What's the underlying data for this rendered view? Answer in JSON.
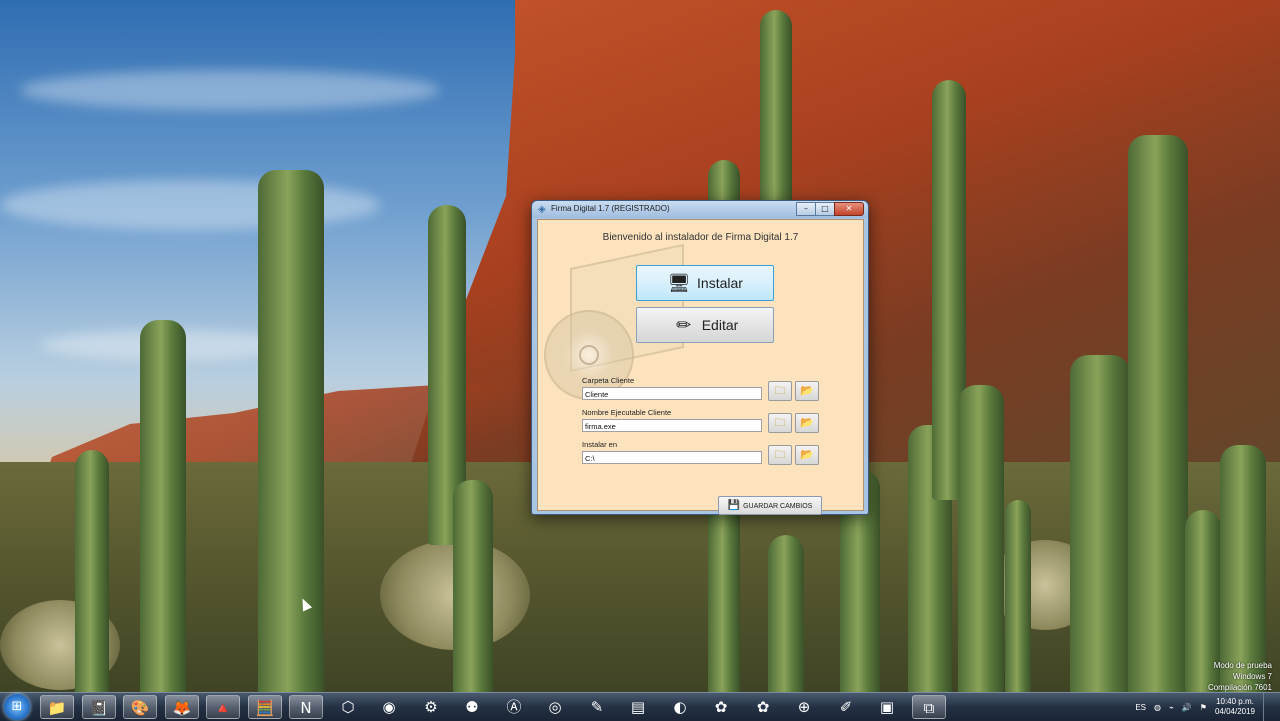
{
  "window": {
    "title": "Firma Digital 1.7 (REGISTRADO)",
    "buttons": {
      "minimize": "–",
      "maximize": "□",
      "close": "✕"
    }
  },
  "installer": {
    "welcome": "Bienvenido al instalador de Firma Digital 1.7",
    "install_label": "Instalar",
    "edit_label": "Editar",
    "fields": [
      {
        "label": "Carpeta Cliente",
        "value": "Cliente"
      },
      {
        "label": "Nombre Ejecutable Cliente",
        "value": "firma.exe"
      },
      {
        "label": "Instalar en",
        "value": "C:\\"
      }
    ],
    "save_label": "GUARDAR CAMBIOS"
  },
  "watermark": {
    "line1": "Modo de prueba",
    "line2": "Windows 7",
    "line3": "Compilación 7601"
  },
  "taskbar": {
    "start_glyph": "⊞",
    "items": [
      {
        "name": "explorer-icon",
        "glyph": "📁"
      },
      {
        "name": "notes-icon",
        "glyph": "📓"
      },
      {
        "name": "paint-icon",
        "glyph": "🎨"
      },
      {
        "name": "firefox-icon",
        "glyph": "🦊"
      },
      {
        "name": "vlc-icon",
        "glyph": "🔺"
      },
      {
        "name": "calculator-icon",
        "glyph": "🧮"
      },
      {
        "name": "onenote-icon",
        "glyph": "N"
      },
      {
        "name": "box-icon",
        "glyph": "⬡"
      },
      {
        "name": "chrome-icon",
        "glyph": "◉"
      },
      {
        "name": "settings-icon",
        "glyph": "⚙"
      },
      {
        "name": "remote-icon",
        "glyph": "⚉"
      },
      {
        "name": "app-a-icon",
        "glyph": "Ⓐ"
      },
      {
        "name": "obs-icon",
        "glyph": "◎"
      },
      {
        "name": "editor-icon",
        "glyph": "✎"
      },
      {
        "name": "window-icon",
        "glyph": "▤"
      },
      {
        "name": "ball-icon",
        "glyph": "◐"
      },
      {
        "name": "paw-icon",
        "glyph": "✿"
      },
      {
        "name": "paw2-icon",
        "glyph": "✿"
      },
      {
        "name": "network-icon",
        "glyph": "⊕"
      },
      {
        "name": "pencil-icon",
        "glyph": "✐"
      },
      {
        "name": "monitor-icon",
        "glyph": "▣"
      },
      {
        "name": "installer-icon",
        "glyph": "⧉"
      }
    ],
    "tray": {
      "language": "ES",
      "time": "10:40 p.m.",
      "date": "04/04/2019"
    }
  }
}
